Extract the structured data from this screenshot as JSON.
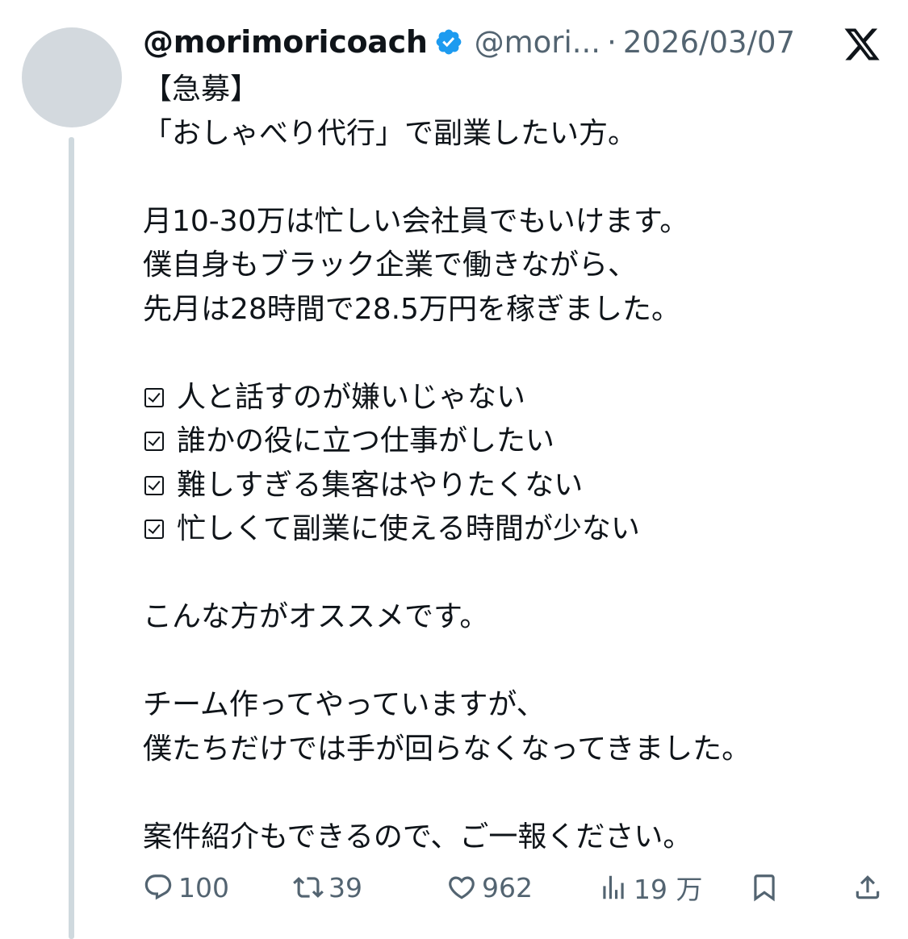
{
  "author": {
    "display_name": "@morimoricoach",
    "handle": "@mori...",
    "separator": "·",
    "date": "2026/03/07"
  },
  "colors": {
    "verified_badge": "#1d9bf0",
    "secondary_text": "#536471",
    "avatar_placeholder": "#d3d9de",
    "thread_line": "#cfd9de"
  },
  "tweet": {
    "lines": [
      "【急募】",
      "「おしゃべり代行」で副業したい方。",
      "",
      "月10-30万は忙しい会社員でもいけます。",
      "僕自身もブラック企業で働きながら、",
      "先月は28時間で28.5万円を稼ぎました。",
      "",
      "人と話すのが嫌いじゃない",
      "誰かの役に立つ仕事がしたい",
      "難しすぎる集客はやりたくない",
      "忙しくて副業に使える時間が少ない",
      "",
      "こんな方がオススメです。",
      "",
      "チーム作ってやっていますが、",
      "僕たちだけでは手が回らなくなってきました。",
      "",
      "案件紹介もできるので、ご一報ください。"
    ]
  },
  "actions": {
    "replies": "100",
    "reposts": "39",
    "likes": "962",
    "views": "19 万"
  },
  "icons": {
    "verified": "verified-badge-icon",
    "x_logo": "x-logo-icon",
    "reply": "reply-icon",
    "repost": "repost-icon",
    "like": "heart-icon",
    "views": "views-chart-icon",
    "bookmark": "bookmark-icon",
    "share": "share-icon"
  }
}
